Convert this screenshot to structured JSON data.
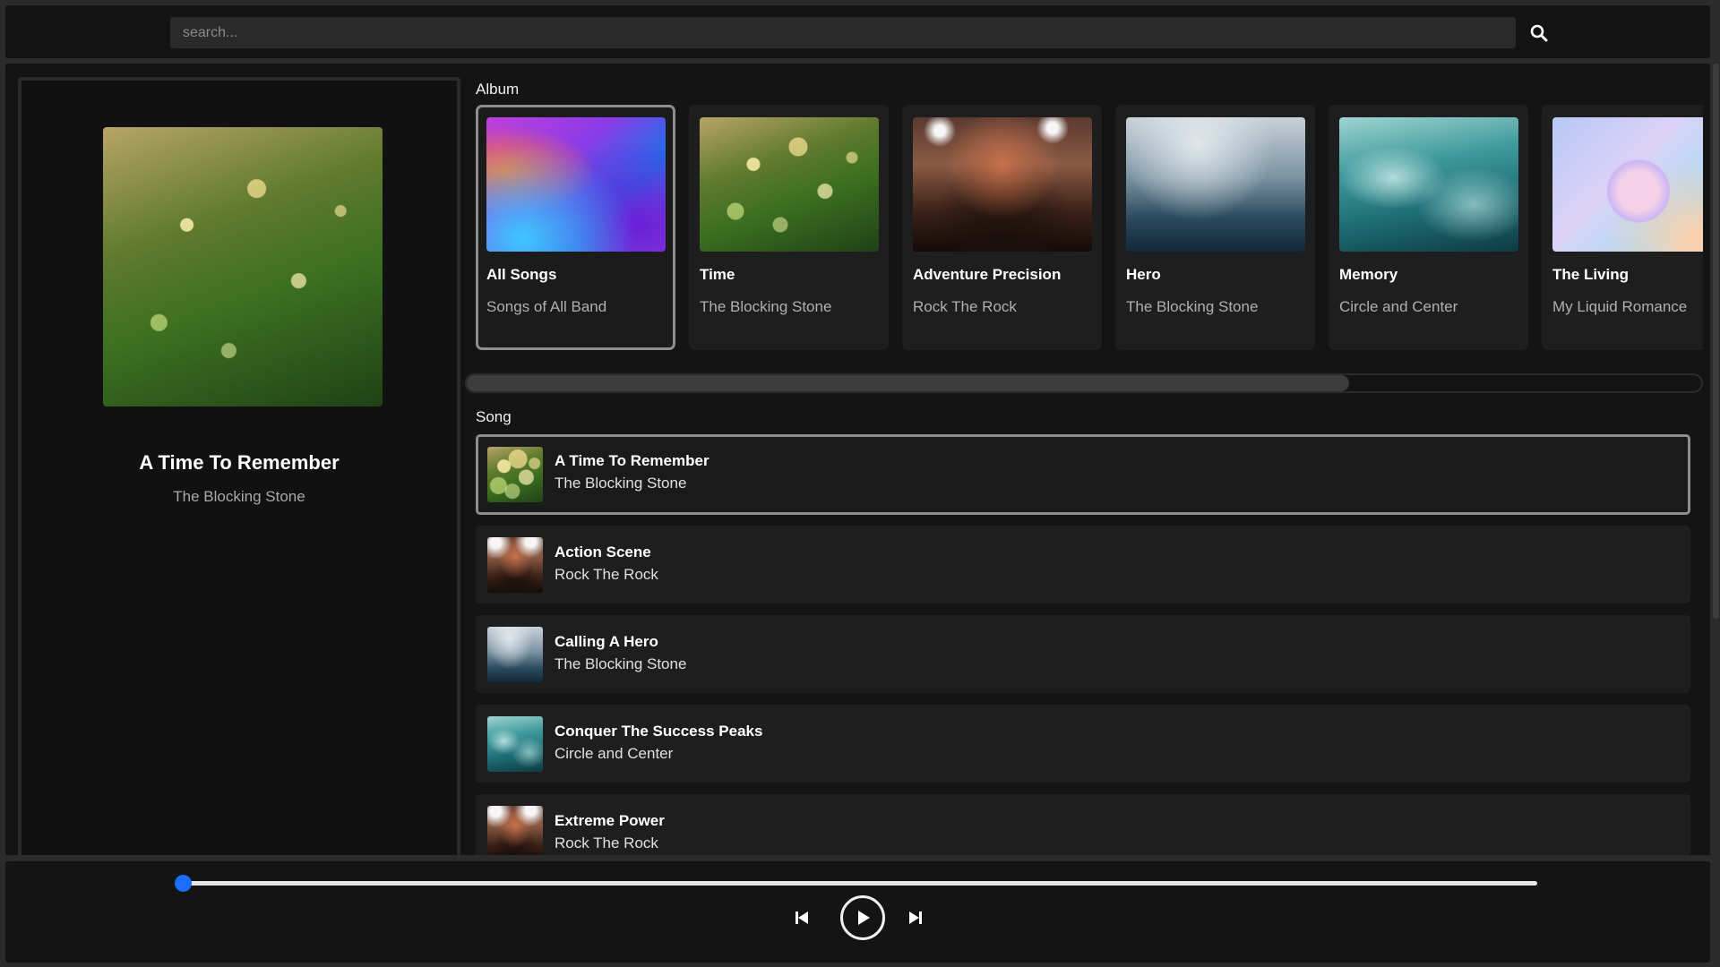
{
  "search": {
    "placeholder": "search..."
  },
  "now_playing": {
    "title": "A Time To Remember",
    "artist": "The Blocking Stone",
    "art": "grass"
  },
  "sections": {
    "album_label": "Album",
    "song_label": "Song"
  },
  "albums": [
    {
      "title": "All Songs",
      "subtitle": "Songs of All Band",
      "art": "gradient",
      "selected": true
    },
    {
      "title": "Time",
      "subtitle": "The Blocking Stone",
      "art": "grass",
      "selected": false
    },
    {
      "title": "Adventure Precision",
      "subtitle": "Rock The Rock",
      "art": "concert",
      "selected": false
    },
    {
      "title": "Hero",
      "subtitle": "The Blocking Stone",
      "art": "mist",
      "selected": false
    },
    {
      "title": "Memory",
      "subtitle": "Circle and Center",
      "art": "waves",
      "selected": false
    },
    {
      "title": "The Living",
      "subtitle": "My Liquid Romance",
      "art": "pastel",
      "selected": false
    }
  ],
  "songs": [
    {
      "title": "A Time To Remember",
      "artist": "The Blocking Stone",
      "art": "grass",
      "selected": true
    },
    {
      "title": "Action Scene",
      "artist": "Rock The Rock",
      "art": "concert",
      "selected": false
    },
    {
      "title": "Calling A Hero",
      "artist": "The Blocking Stone",
      "art": "mist",
      "selected": false
    },
    {
      "title": "Conquer The Success Peaks",
      "artist": "Circle and Center",
      "art": "waves",
      "selected": false
    },
    {
      "title": "Extreme Power",
      "artist": "Rock The Rock",
      "art": "concert",
      "selected": false
    }
  ],
  "player": {
    "progress": 0,
    "controls": [
      "skip-previous-icon",
      "play-icon",
      "skip-next-icon"
    ]
  },
  "colors": {
    "accent": "#1a6dff",
    "panel": "#141414",
    "card": "#1e1e1e",
    "selected_border": "#8e8e8e"
  }
}
